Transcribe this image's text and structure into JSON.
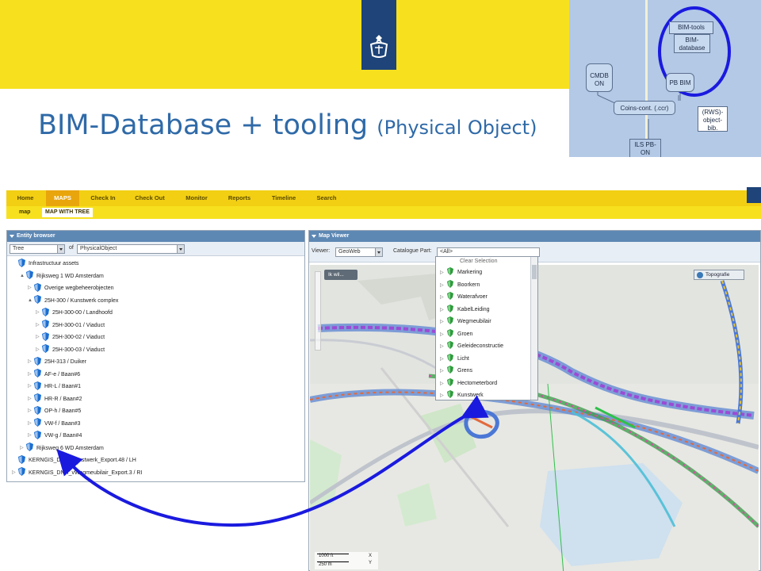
{
  "slide": {
    "title": "BIM-Database + tooling",
    "subtitle": "(Physical Object)"
  },
  "architecture": {
    "cmdb": "CMDB ON",
    "pb_bim": "PB BIM",
    "bim_tools": "BIM-tools",
    "bim_database": "BIM-database",
    "coins": "Coins-cont. (.ccr)",
    "ils": "ILS PB-ON",
    "rws": "(RWS)-object-bib."
  },
  "app": {
    "nav_tabs": [
      "Home",
      "MAPS",
      "Check In",
      "Check Out",
      "Monitor",
      "Reports",
      "Timeline",
      "Search"
    ],
    "active_tab": "MAPS",
    "sub_tabs": [
      "map",
      "MAP WITH TREE"
    ],
    "active_sub_tab": "MAP WITH TREE"
  },
  "entity_browser": {
    "title": "Entity browser",
    "view_select": "Tree",
    "of_label": "of",
    "type_select": "PhysicalObject",
    "tree": [
      {
        "label": "Infrastructuur assets",
        "expander": ""
      },
      {
        "label": "Rijksweg 1 WD Amsterdam",
        "expander": "▲"
      },
      {
        "label": "Overige wegbeheerobjecten",
        "expander": "▷"
      },
      {
        "label": "25H-300 / Kunstwerk complex",
        "expander": "▲"
      },
      {
        "label": "25H-300-00 / Landhoofd",
        "expander": "▷"
      },
      {
        "label": "25H-300-01 / Viaduct",
        "expander": "▷"
      },
      {
        "label": "25H-300-02 / Viaduct",
        "expander": "▷"
      },
      {
        "label": "25H-300-03 / Viaduct",
        "expander": "▷"
      },
      {
        "label": "25H-313 / Duiker",
        "expander": "▷"
      },
      {
        "label": "AF-e / Baan#6",
        "expander": "▷"
      },
      {
        "label": "HR-L / Baan#1",
        "expander": "▷"
      },
      {
        "label": "HR-R / Baan#2",
        "expander": "▷"
      },
      {
        "label": "OP-h / Baan#5",
        "expander": "▷"
      },
      {
        "label": "VW-f / Baan#3",
        "expander": "▷"
      },
      {
        "label": "VW-g / Baan#4",
        "expander": "▷"
      },
      {
        "label": "Rijksweg 6 WD Amsterdam",
        "expander": "▷"
      },
      {
        "label": "KERNGIS_DNH_Kunstwerk_Export.48 / LH",
        "expander": ""
      },
      {
        "label": "KERNGIS_DNH_vWegmeubilair_Export.3 / RI",
        "expander": "▷"
      }
    ]
  },
  "map_viewer": {
    "title": "Map Viewer",
    "viewer_label": "Viewer:",
    "viewer_value": "GeoWeb",
    "catalogue_label": "Catalogue Part:",
    "catalogue_value": "<All>",
    "ik_wil": "Ik wil...",
    "basemap": "Topografie",
    "scale_ft": "1000 ft",
    "scale_m": "250 m",
    "x_label": "X",
    "y_label": "Y"
  },
  "catalogue_dropdown": {
    "clear": "Clear Selection",
    "items": [
      "Markering",
      "Boorkern",
      "Waterafvoer",
      "KabelLeiding",
      "Wegmeubilair",
      "Groen",
      "Geleideconstructie",
      "Licht",
      "Grens",
      "Hectometerbord",
      "Kunstwerk"
    ]
  },
  "colors": {
    "yellow": "#f7e11e",
    "nav_yellow": "#f2cf13",
    "active_tab": "#e9a50c",
    "title_blue": "#2f6aa8",
    "panel_head": "#5d88b4",
    "annotation": "#1a1adf"
  }
}
